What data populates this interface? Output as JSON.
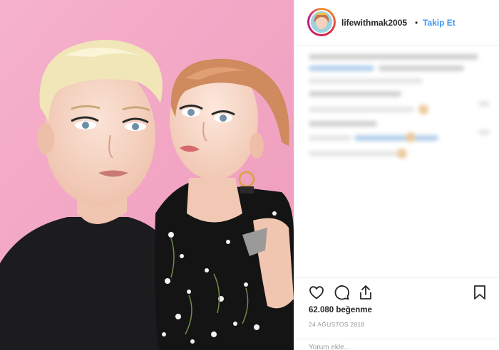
{
  "post": {
    "username": "lifewithmak2005",
    "separator": "•",
    "follow_label": "Takip Et",
    "likes_text": "62.080 beğenme",
    "date_text": "24 AĞUSTOS 2018",
    "comment_placeholder": "Yorum ekle..."
  },
  "icons": {
    "like": "heart-icon",
    "comment": "speech-bubble-icon",
    "share": "share-icon",
    "save": "bookmark-icon"
  },
  "colors": {
    "photo_background": "#f4a9c6",
    "link": "#3897f0",
    "text": "#262626",
    "muted": "#999999",
    "divider": "#efefef"
  }
}
